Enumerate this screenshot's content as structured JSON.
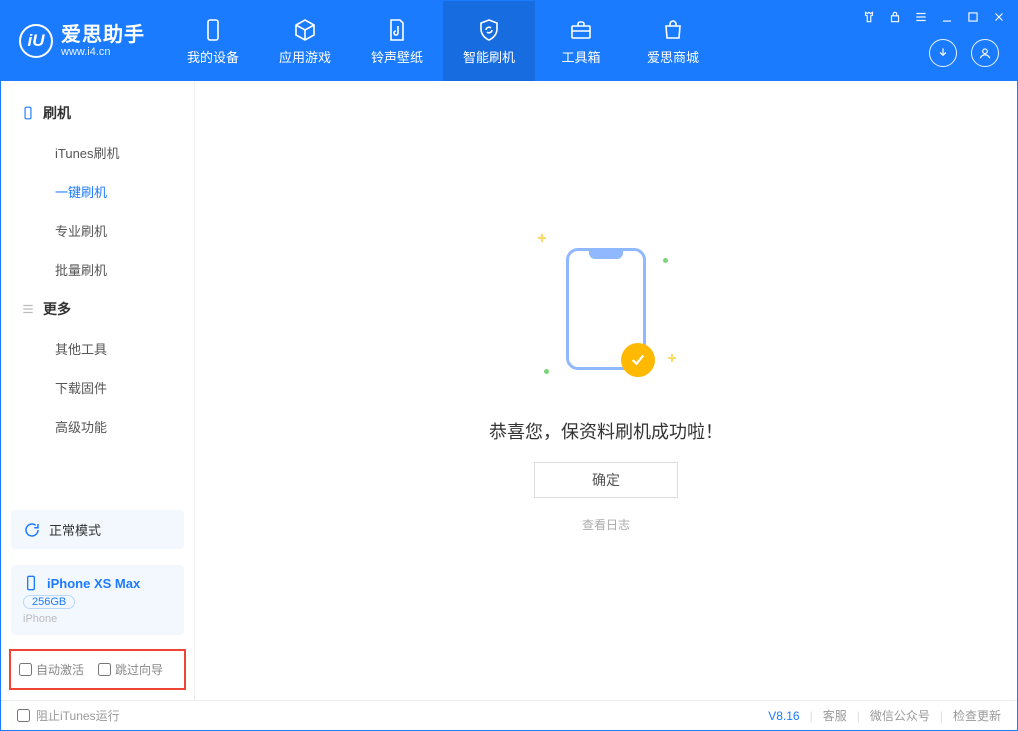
{
  "app": {
    "name": "爱思助手",
    "domain": "www.i4.cn",
    "logo_letter": "iU"
  },
  "nav": {
    "items": [
      {
        "label": "我的设备"
      },
      {
        "label": "应用游戏"
      },
      {
        "label": "铃声壁纸"
      },
      {
        "label": "智能刷机"
      },
      {
        "label": "工具箱"
      },
      {
        "label": "爱思商城"
      }
    ],
    "active_index": 3
  },
  "sidebar": {
    "group_flash": {
      "title": "刷机",
      "items": [
        "iTunes刷机",
        "一键刷机",
        "专业刷机",
        "批量刷机"
      ],
      "active_index": 1
    },
    "group_more": {
      "title": "更多",
      "items": [
        "其他工具",
        "下载固件",
        "高级功能"
      ]
    },
    "mode": {
      "label": "正常模式"
    },
    "device": {
      "name": "iPhone XS Max",
      "storage": "256GB",
      "type": "iPhone"
    },
    "checks": {
      "auto_activate": "自动激活",
      "skip_guide": "跳过向导"
    }
  },
  "main": {
    "success_text": "恭喜您，保资料刷机成功啦！",
    "confirm": "确定",
    "view_log": "查看日志"
  },
  "footer": {
    "block_itunes": "阻止iTunes运行",
    "version": "V8.16",
    "links": [
      "客服",
      "微信公众号",
      "检查更新"
    ]
  }
}
